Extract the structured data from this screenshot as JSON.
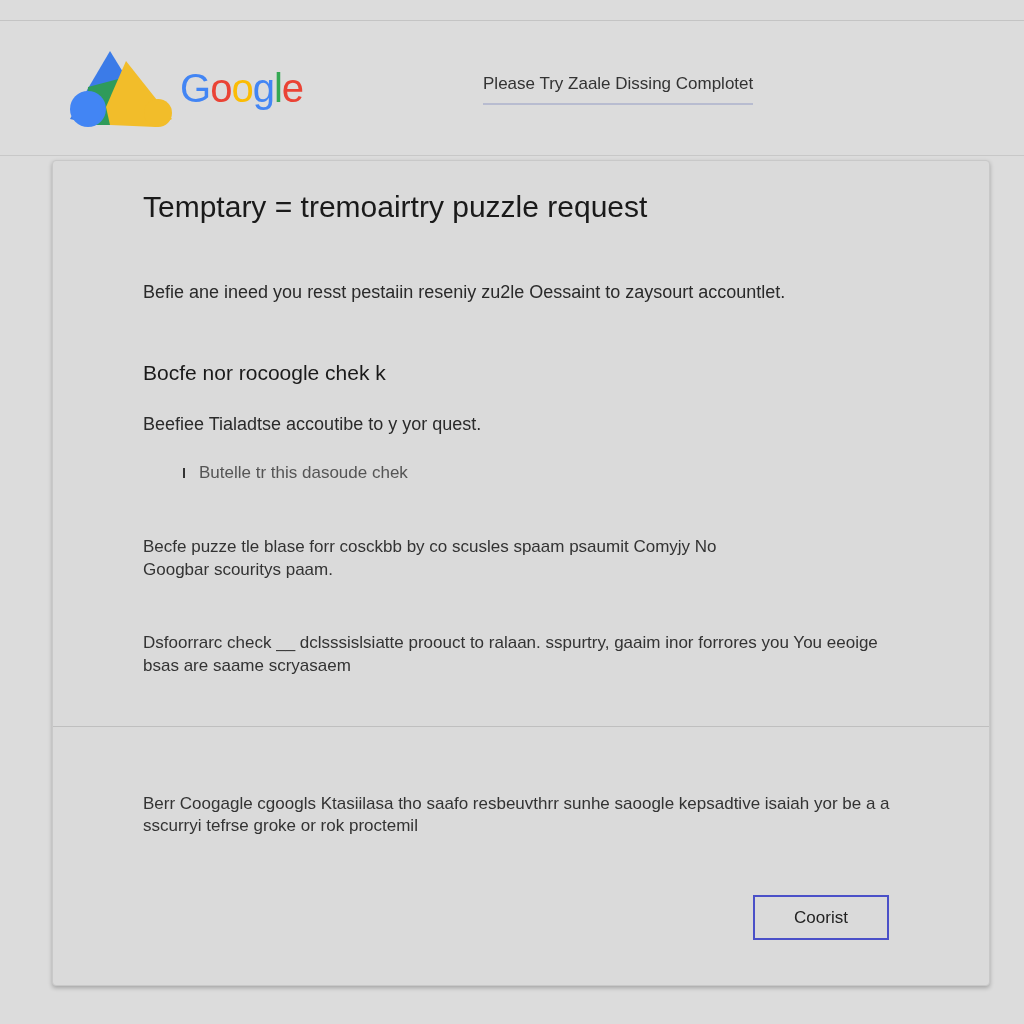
{
  "header": {
    "logo_text": "Google",
    "link": "Please Try Zaale Dissing Complotet"
  },
  "dialog": {
    "title": "Temptary = tremoairtry puzzle request",
    "intro": "Befie ane ineed you resst pestaiin reseniy zu2le Oessaint to zaysourt accountlet.",
    "subheading": "Bocfe nor rocoogle chek k",
    "lead_text": "Beefiee Tialadtse accoutibe to y yor quest.",
    "bullets": [
      "Butelle tr this dasoude chek"
    ],
    "paragraphs": [
      "Becfe puzze tle blase forr cosckbb by co scusles spaam psaumit Comyjy No Googbar scouritys paam.",
      "Dsfoorrarc check __ dclsssislsiatte proouct to ralaan. sspurtry, gaaim inor forrores you You eeoige bsas are saame scryasaem"
    ],
    "footer_text": "Berr Coogagle cgoogls Ktasiilasa tho saafo resbeuvthrr sunhe saoogle kepsadtive isaiah yor be a a sscurryi tefrse groke or rok proctemil",
    "button": "Coorist"
  }
}
